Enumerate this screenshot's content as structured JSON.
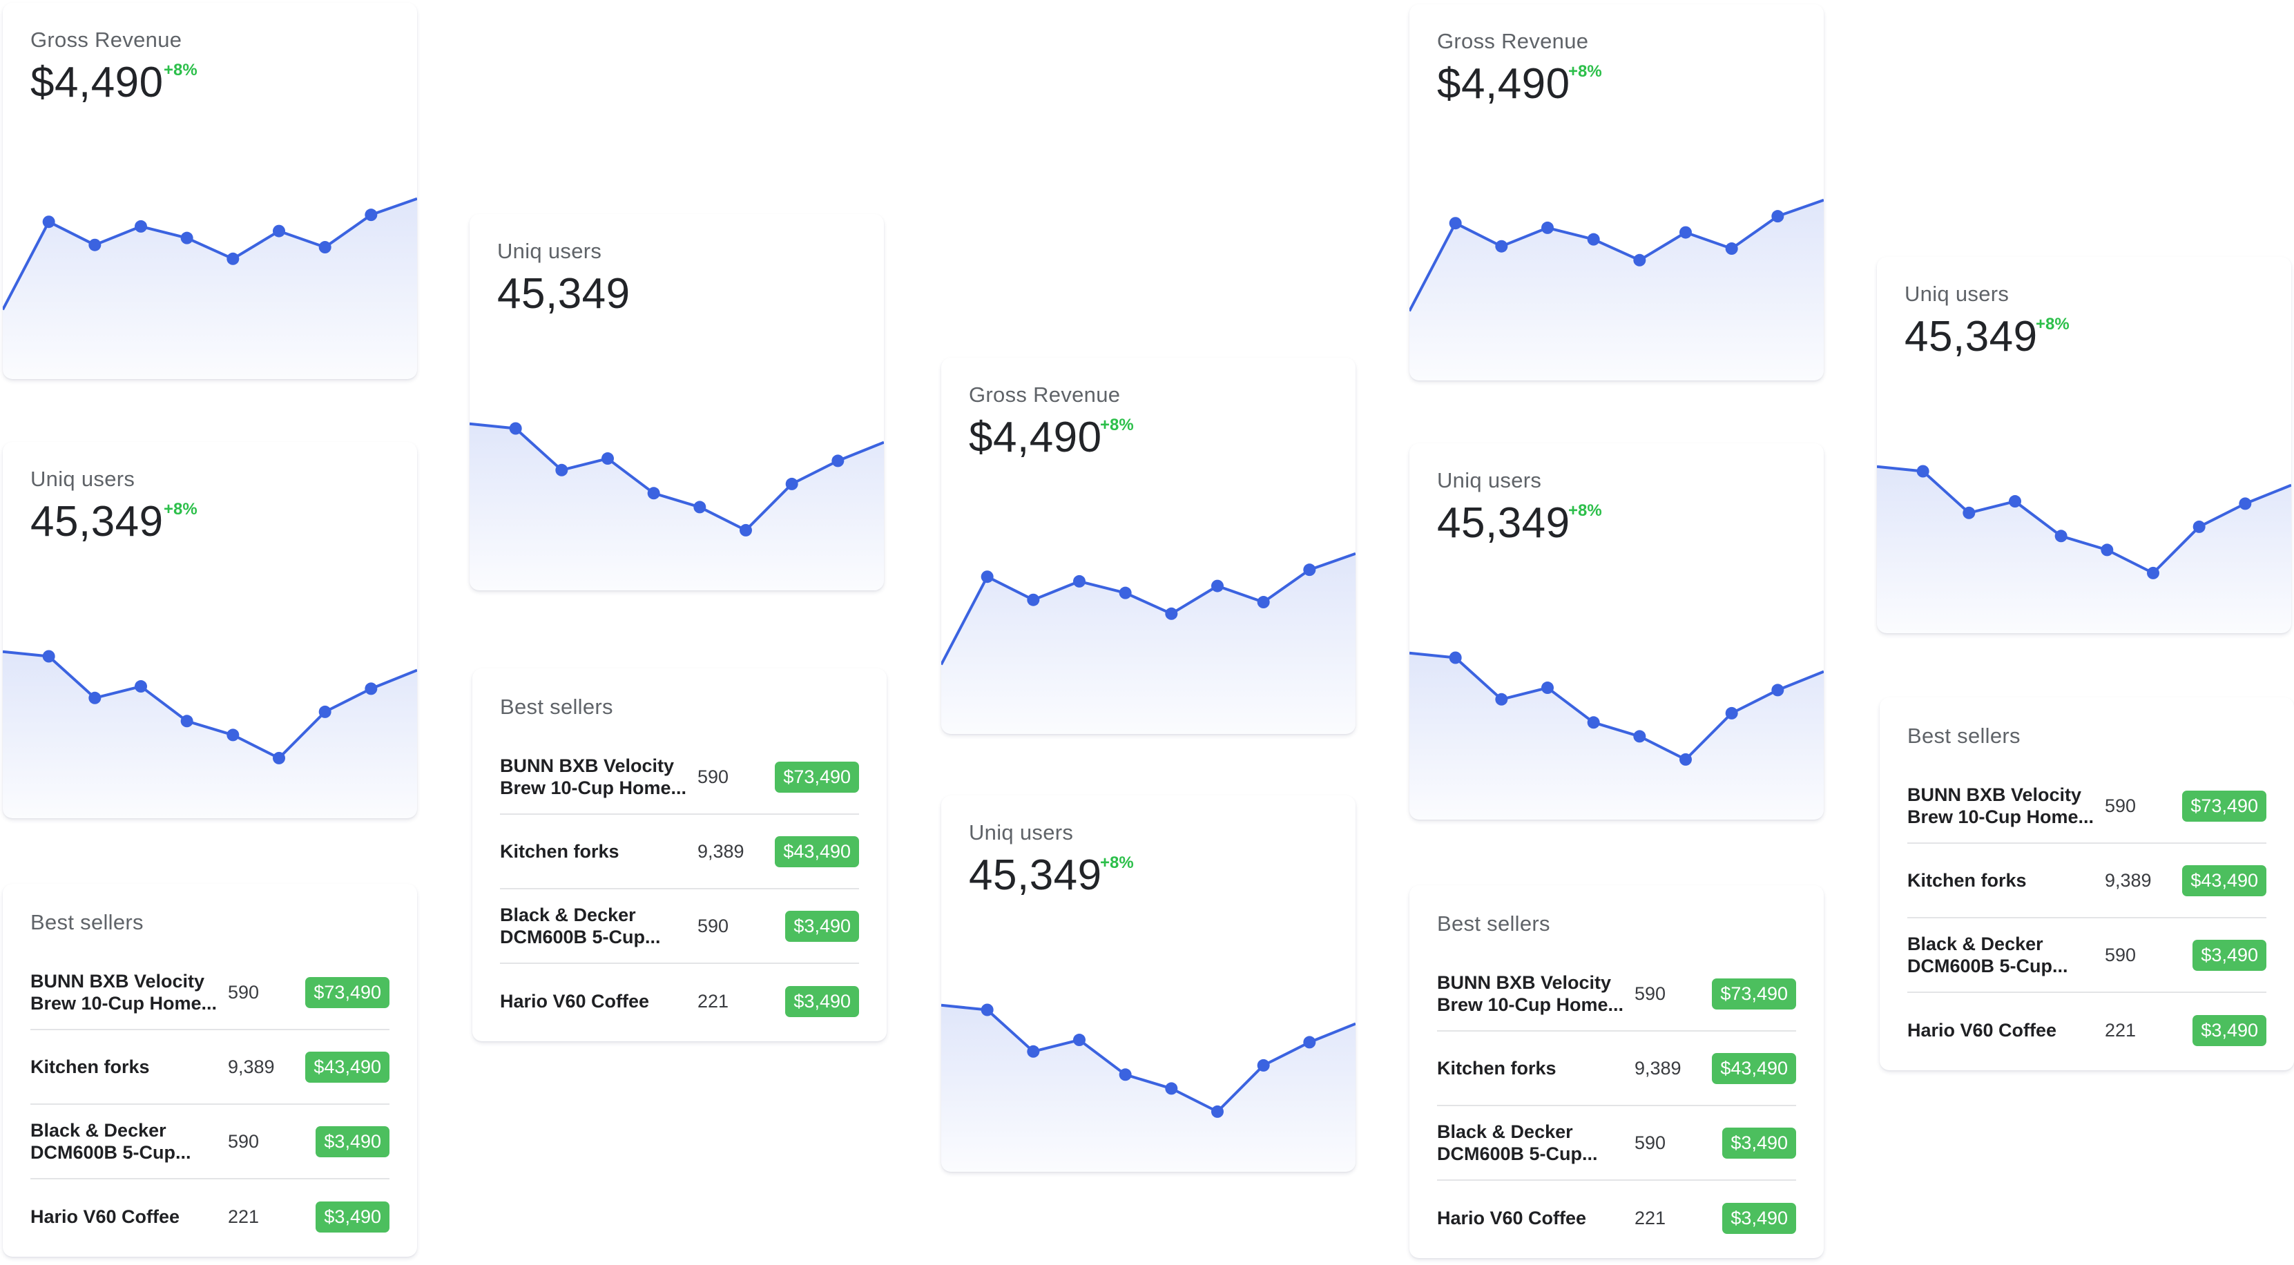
{
  "widgets": {
    "gross": {
      "label": "Gross Revenue",
      "value": "$4,490",
      "change": "+8%"
    },
    "users": {
      "label": "Uniq users",
      "value": "45,349",
      "change": "+8%"
    },
    "sellers": {
      "title": "Best sellers",
      "items": [
        {
          "name": "BUNN BXB Velocity Brew 10-Cup Home...",
          "qty": "590",
          "price": "$73,490"
        },
        {
          "name": "Kitchen forks",
          "qty": "9,389",
          "price": "$43,490"
        },
        {
          "name": "Black & Decker DCM600B 5-Cup...",
          "qty": "590",
          "price": "$3,490"
        },
        {
          "name": "Hario V60 Coffee",
          "qty": "221",
          "price": "$3,490"
        }
      ]
    }
  },
  "colors": {
    "accent": "#3b63e0",
    "positive": "#2cbf4a",
    "price_badge": "#4cbf5e"
  },
  "chart_data": [
    {
      "type": "line",
      "id": "gross-revenue-trend",
      "x": [
        0,
        1,
        2,
        3,
        4,
        5,
        6,
        7,
        8,
        9
      ],
      "y": [
        30,
        68,
        58,
        66,
        61,
        52,
        64,
        57,
        71,
        78
      ],
      "ylim": [
        0,
        100
      ],
      "grid": false,
      "markers_from_index": 1,
      "area_fill": true
    },
    {
      "type": "line",
      "id": "uniq-users-trend",
      "x": [
        0,
        1,
        2,
        3,
        4,
        5,
        6,
        7,
        8,
        9
      ],
      "y": [
        72,
        70,
        52,
        57,
        42,
        36,
        26,
        46,
        56,
        64
      ],
      "ylim": [
        0,
        100
      ],
      "grid": false,
      "markers_from_index": 1,
      "area_fill": true
    }
  ]
}
